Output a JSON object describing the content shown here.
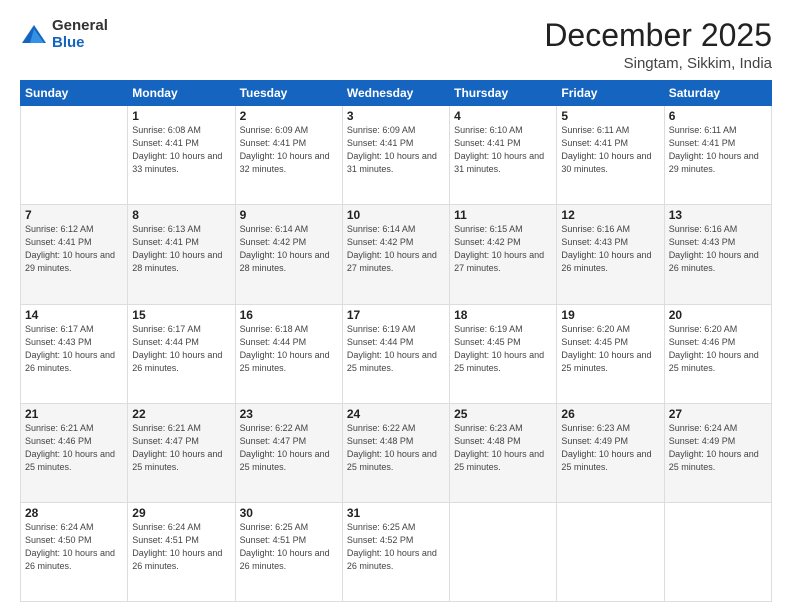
{
  "logo": {
    "general": "General",
    "blue": "Blue"
  },
  "header": {
    "month": "December 2025",
    "location": "Singtam, Sikkim, India"
  },
  "weekdays": [
    "Sunday",
    "Monday",
    "Tuesday",
    "Wednesday",
    "Thursday",
    "Friday",
    "Saturday"
  ],
  "weeks": [
    [
      {
        "day": "",
        "sunrise": "",
        "sunset": "",
        "daylight": ""
      },
      {
        "day": "1",
        "sunrise": "Sunrise: 6:08 AM",
        "sunset": "Sunset: 4:41 PM",
        "daylight": "Daylight: 10 hours and 33 minutes."
      },
      {
        "day": "2",
        "sunrise": "Sunrise: 6:09 AM",
        "sunset": "Sunset: 4:41 PM",
        "daylight": "Daylight: 10 hours and 32 minutes."
      },
      {
        "day": "3",
        "sunrise": "Sunrise: 6:09 AM",
        "sunset": "Sunset: 4:41 PM",
        "daylight": "Daylight: 10 hours and 31 minutes."
      },
      {
        "day": "4",
        "sunrise": "Sunrise: 6:10 AM",
        "sunset": "Sunset: 4:41 PM",
        "daylight": "Daylight: 10 hours and 31 minutes."
      },
      {
        "day": "5",
        "sunrise": "Sunrise: 6:11 AM",
        "sunset": "Sunset: 4:41 PM",
        "daylight": "Daylight: 10 hours and 30 minutes."
      },
      {
        "day": "6",
        "sunrise": "Sunrise: 6:11 AM",
        "sunset": "Sunset: 4:41 PM",
        "daylight": "Daylight: 10 hours and 29 minutes."
      }
    ],
    [
      {
        "day": "7",
        "sunrise": "Sunrise: 6:12 AM",
        "sunset": "Sunset: 4:41 PM",
        "daylight": "Daylight: 10 hours and 29 minutes."
      },
      {
        "day": "8",
        "sunrise": "Sunrise: 6:13 AM",
        "sunset": "Sunset: 4:41 PM",
        "daylight": "Daylight: 10 hours and 28 minutes."
      },
      {
        "day": "9",
        "sunrise": "Sunrise: 6:14 AM",
        "sunset": "Sunset: 4:42 PM",
        "daylight": "Daylight: 10 hours and 28 minutes."
      },
      {
        "day": "10",
        "sunrise": "Sunrise: 6:14 AM",
        "sunset": "Sunset: 4:42 PM",
        "daylight": "Daylight: 10 hours and 27 minutes."
      },
      {
        "day": "11",
        "sunrise": "Sunrise: 6:15 AM",
        "sunset": "Sunset: 4:42 PM",
        "daylight": "Daylight: 10 hours and 27 minutes."
      },
      {
        "day": "12",
        "sunrise": "Sunrise: 6:16 AM",
        "sunset": "Sunset: 4:43 PM",
        "daylight": "Daylight: 10 hours and 26 minutes."
      },
      {
        "day": "13",
        "sunrise": "Sunrise: 6:16 AM",
        "sunset": "Sunset: 4:43 PM",
        "daylight": "Daylight: 10 hours and 26 minutes."
      }
    ],
    [
      {
        "day": "14",
        "sunrise": "Sunrise: 6:17 AM",
        "sunset": "Sunset: 4:43 PM",
        "daylight": "Daylight: 10 hours and 26 minutes."
      },
      {
        "day": "15",
        "sunrise": "Sunrise: 6:17 AM",
        "sunset": "Sunset: 4:44 PM",
        "daylight": "Daylight: 10 hours and 26 minutes."
      },
      {
        "day": "16",
        "sunrise": "Sunrise: 6:18 AM",
        "sunset": "Sunset: 4:44 PM",
        "daylight": "Daylight: 10 hours and 25 minutes."
      },
      {
        "day": "17",
        "sunrise": "Sunrise: 6:19 AM",
        "sunset": "Sunset: 4:44 PM",
        "daylight": "Daylight: 10 hours and 25 minutes."
      },
      {
        "day": "18",
        "sunrise": "Sunrise: 6:19 AM",
        "sunset": "Sunset: 4:45 PM",
        "daylight": "Daylight: 10 hours and 25 minutes."
      },
      {
        "day": "19",
        "sunrise": "Sunrise: 6:20 AM",
        "sunset": "Sunset: 4:45 PM",
        "daylight": "Daylight: 10 hours and 25 minutes."
      },
      {
        "day": "20",
        "sunrise": "Sunrise: 6:20 AM",
        "sunset": "Sunset: 4:46 PM",
        "daylight": "Daylight: 10 hours and 25 minutes."
      }
    ],
    [
      {
        "day": "21",
        "sunrise": "Sunrise: 6:21 AM",
        "sunset": "Sunset: 4:46 PM",
        "daylight": "Daylight: 10 hours and 25 minutes."
      },
      {
        "day": "22",
        "sunrise": "Sunrise: 6:21 AM",
        "sunset": "Sunset: 4:47 PM",
        "daylight": "Daylight: 10 hours and 25 minutes."
      },
      {
        "day": "23",
        "sunrise": "Sunrise: 6:22 AM",
        "sunset": "Sunset: 4:47 PM",
        "daylight": "Daylight: 10 hours and 25 minutes."
      },
      {
        "day": "24",
        "sunrise": "Sunrise: 6:22 AM",
        "sunset": "Sunset: 4:48 PM",
        "daylight": "Daylight: 10 hours and 25 minutes."
      },
      {
        "day": "25",
        "sunrise": "Sunrise: 6:23 AM",
        "sunset": "Sunset: 4:48 PM",
        "daylight": "Daylight: 10 hours and 25 minutes."
      },
      {
        "day": "26",
        "sunrise": "Sunrise: 6:23 AM",
        "sunset": "Sunset: 4:49 PM",
        "daylight": "Daylight: 10 hours and 25 minutes."
      },
      {
        "day": "27",
        "sunrise": "Sunrise: 6:24 AM",
        "sunset": "Sunset: 4:49 PM",
        "daylight": "Daylight: 10 hours and 25 minutes."
      }
    ],
    [
      {
        "day": "28",
        "sunrise": "Sunrise: 6:24 AM",
        "sunset": "Sunset: 4:50 PM",
        "daylight": "Daylight: 10 hours and 26 minutes."
      },
      {
        "day": "29",
        "sunrise": "Sunrise: 6:24 AM",
        "sunset": "Sunset: 4:51 PM",
        "daylight": "Daylight: 10 hours and 26 minutes."
      },
      {
        "day": "30",
        "sunrise": "Sunrise: 6:25 AM",
        "sunset": "Sunset: 4:51 PM",
        "daylight": "Daylight: 10 hours and 26 minutes."
      },
      {
        "day": "31",
        "sunrise": "Sunrise: 6:25 AM",
        "sunset": "Sunset: 4:52 PM",
        "daylight": "Daylight: 10 hours and 26 minutes."
      },
      {
        "day": "",
        "sunrise": "",
        "sunset": "",
        "daylight": ""
      },
      {
        "day": "",
        "sunrise": "",
        "sunset": "",
        "daylight": ""
      },
      {
        "day": "",
        "sunrise": "",
        "sunset": "",
        "daylight": ""
      }
    ]
  ]
}
